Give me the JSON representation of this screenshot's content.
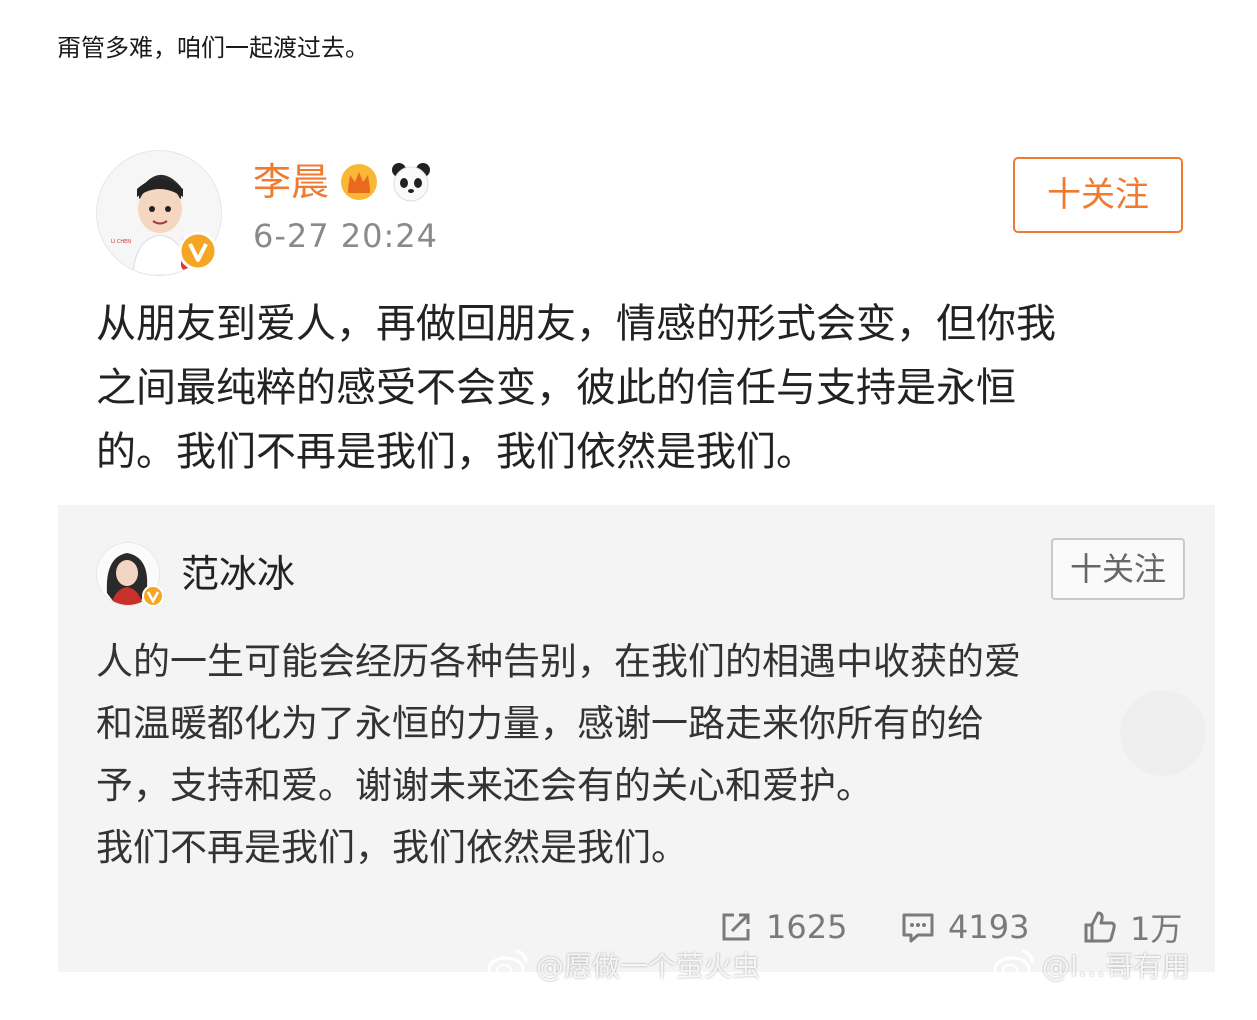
{
  "intro": {
    "text": "甭管多难，咱们一起渡过去。"
  },
  "post": {
    "author": "李晨",
    "time": "6-27 20:24",
    "follow_label": "十关注",
    "text_lines": [
      "从朋友到爱人，再做回朋友，情感的形式会变，但你我",
      "之间最纯粹的感受不会变，彼此的信任与支持是永恒",
      "的。我们不再是我们，我们依然是我们。"
    ],
    "badges": [
      "crown-icon",
      "panda-icon",
      "verified-v-icon"
    ]
  },
  "repost": {
    "author": "范冰冰",
    "follow_label": "十关注",
    "text_lines": [
      "人的一生可能会经历各种告别，在我们的相遇中收获的爱",
      "和温暖都化为了永恒的力量，感谢一路走来你所有的给",
      "予，支持和爱。谢谢未来还会有的关心和爱护。",
      "我们不再是我们，我们依然是我们。"
    ],
    "actions": {
      "share_count": "1625",
      "comment_count": "4193",
      "like_count": "1万"
    }
  },
  "watermarks": {
    "left": "@愿做一个萤火虫",
    "right": "@l…哥有用"
  },
  "colors": {
    "accent": "#f07a30",
    "card_bg": "#f4f4f4",
    "muted": "#8a8a8a"
  }
}
